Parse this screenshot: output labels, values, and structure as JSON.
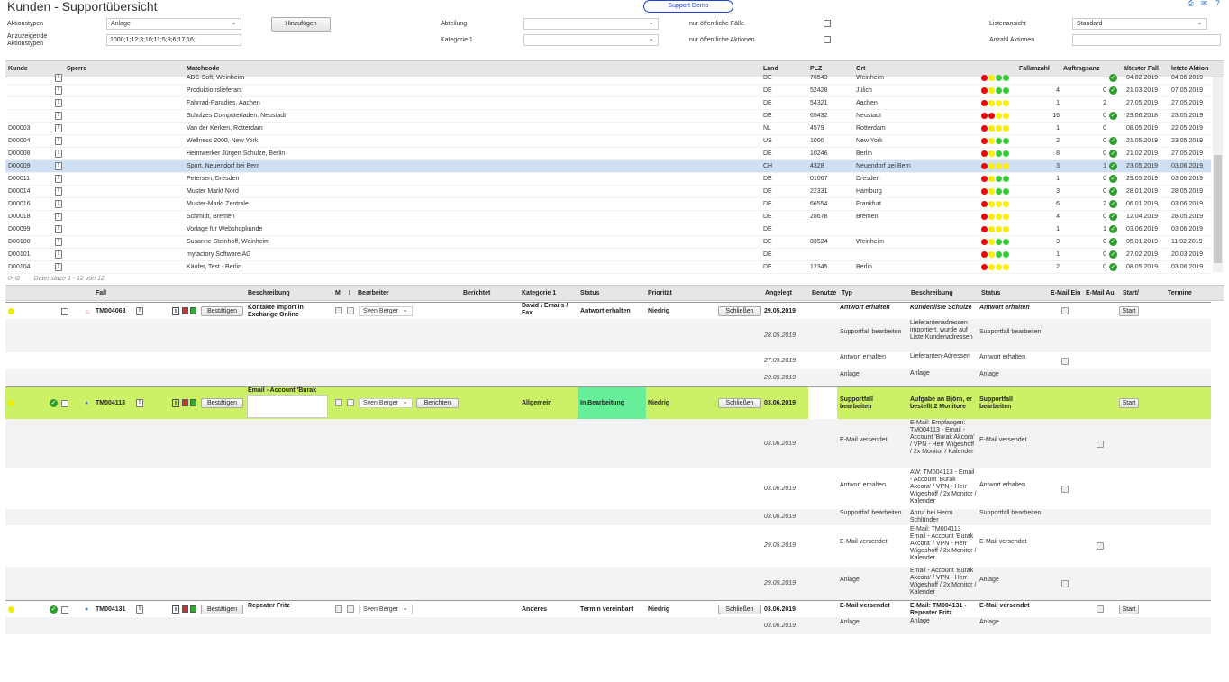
{
  "header": {
    "title": "Kunden - Supportübersicht",
    "demo": "Support Demo"
  },
  "filters": {
    "aktionstypen_label": "Aktionstypen",
    "aktionstypen_value": "Anlage",
    "anzuzeigende_label": "Anzuzeigende Aktionstypen",
    "anzuzeigende_value": "1000;1;12;3;10;11;5;9;6;17;16;",
    "add_btn": "Hinzufügen",
    "abteilung_label": "Abteilung",
    "kategorie_label": "Kategorie 1",
    "nur_faelle": "nur öffentliche Fälle",
    "nur_aktionen": "nur öffentliche Aktionen",
    "listenansicht_label": "Listenansicht",
    "listenansicht_value": "Standard",
    "anzahl_label": "Anzahl Aktionen"
  },
  "customer_grid": {
    "headers": {
      "kunde": "Kunde",
      "sperre": "Sperre",
      "matchcode": "Matchcode",
      "land": "Land",
      "plz": "PLZ",
      "ort": "Ort",
      "fallanzahl": "Fallanzahl",
      "auftrag": "Auftragsanz",
      "aeltester": "ältester Fall",
      "letzte": "letzte Aktion"
    },
    "rows": [
      {
        "kunde": "",
        "match": "ABC-Soft, Weinheim",
        "land": "DE",
        "plz": "76543",
        "ort": "Weinheim",
        "dots": [
          "#e00",
          "#fe0",
          "#3c3",
          "#3c3"
        ],
        "fall": "",
        "auf": "",
        "ok": true,
        "alt": "04.02.2019",
        "letzte": "04.06.2019"
      },
      {
        "kunde": "",
        "match": "Produktionslieferant",
        "land": "DE",
        "plz": "52428",
        "ort": "Jülich",
        "dots": [
          "#e00",
          "#fe0",
          "#3c3",
          "#3c3"
        ],
        "fall": "4",
        "auf": "0",
        "ok": true,
        "alt": "21.03.2019",
        "letzte": "07.05.2019"
      },
      {
        "kunde": "",
        "match": "Fahrrad-Paradies, Aachen",
        "land": "DE",
        "plz": "54321",
        "ort": "Aachen",
        "dots": [
          "#e00",
          "#fe0",
          "#fe0",
          "#fe0"
        ],
        "fall": "1",
        "auf": "2",
        "ok": false,
        "alt": "27.05.2019",
        "letzte": "27.05.2019"
      },
      {
        "kunde": "",
        "match": "Schulzes Computerladen, Neustadt",
        "land": "DE",
        "plz": "65432",
        "ort": "Neustadt",
        "dots": [
          "#e00",
          "#e00",
          "#fe0",
          "#fe0"
        ],
        "fall": "16",
        "auf": "0",
        "ok": true,
        "alt": "29.06.2018",
        "letzte": "23.05.2019"
      },
      {
        "kunde": "D00003",
        "match": "Van der Kerken, Rotterdam",
        "land": "NL",
        "plz": "4579",
        "ort": "Rotterdam",
        "dots": [
          "#e00",
          "#fe0",
          "#fe0",
          "#fe0"
        ],
        "fall": "1",
        "auf": "0",
        "ok": false,
        "alt": "08.05.2019",
        "letzte": "22.05.2019"
      },
      {
        "kunde": "D00004",
        "match": "Wellness 2000, New York",
        "land": "US",
        "plz": "1000",
        "ort": "New York",
        "dots": [
          "#e00",
          "#fe0",
          "#3c3",
          "#3c3"
        ],
        "fall": "2",
        "auf": "0",
        "ok": true,
        "alt": "21.05.2019",
        "letzte": "23.05.2019"
      },
      {
        "kunde": "D00008",
        "match": "Heimwerker Jürgen Schulze, Berlin",
        "land": "DE",
        "plz": "10246",
        "ort": "Berlin",
        "dots": [
          "#e00",
          "#fe0",
          "#3c3",
          "#3c3"
        ],
        "fall": "8",
        "auf": "0",
        "ok": true,
        "alt": "21.02.2019",
        "letzte": "27.05.2019"
      },
      {
        "kunde": "D00009",
        "match": "Sport, Neuendorf bei Bern",
        "land": "CH",
        "plz": "4328",
        "ort": "Neuendorf bei Bern",
        "dots": [
          "#e00",
          "#fe0",
          "#fe0",
          "#fe0"
        ],
        "fall": "3",
        "auf": "1",
        "ok": true,
        "alt": "23.05.2019",
        "letzte": "03.06.2019",
        "selected": true
      },
      {
        "kunde": "D00011",
        "match": "Petersen, Dresden",
        "land": "DE",
        "plz": "01067",
        "ort": "Dresden",
        "dots": [
          "#e00",
          "#fe0",
          "#3c3",
          "#3c3"
        ],
        "fall": "1",
        "auf": "0",
        "ok": true,
        "alt": "29.05.2019",
        "letzte": "03.06.2019"
      },
      {
        "kunde": "D00014",
        "match": "Muster Markt Nord",
        "land": "DE",
        "plz": "22331",
        "ort": "Hamburg",
        "dots": [
          "#e00",
          "#fe0",
          "#3c3",
          "#3c3"
        ],
        "fall": "3",
        "auf": "0",
        "ok": true,
        "alt": "28.01.2019",
        "letzte": "28.05.2019"
      },
      {
        "kunde": "D00016",
        "match": "Muster-Markt Zentrale",
        "land": "DE",
        "plz": "66554",
        "ort": "Frankfurt",
        "dots": [
          "#e00",
          "#fe0",
          "#fe0",
          "#fe0"
        ],
        "fall": "6",
        "auf": "2",
        "ok": true,
        "alt": "06.01.2019",
        "letzte": "03.06.2019"
      },
      {
        "kunde": "D00018",
        "match": "Schmidt, Bremen",
        "land": "DE",
        "plz": "28678",
        "ort": "Bremen",
        "dots": [
          "#e00",
          "#fe0",
          "#fe0",
          "#fe0"
        ],
        "fall": "4",
        "auf": "0",
        "ok": true,
        "alt": "12.04.2019",
        "letzte": "28.05.2019"
      },
      {
        "kunde": "D00099",
        "match": "Vorlage für Webshopkunde",
        "land": "DE",
        "plz": "",
        "ort": "",
        "dots": [
          "#e00",
          "#fe0",
          "#fe0",
          "#fe0"
        ],
        "fall": "1",
        "auf": "1",
        "ok": true,
        "alt": "03.06.2019",
        "letzte": "03.06.2019"
      },
      {
        "kunde": "D00100",
        "match": "Susanne Steinhoff, Weinheim",
        "land": "DE",
        "plz": "83524",
        "ort": "Weinheim",
        "dots": [
          "#e00",
          "#fe0",
          "#3c3",
          "#3c3"
        ],
        "fall": "3",
        "auf": "0",
        "ok": true,
        "alt": "05.01.2019",
        "letzte": "11.02.2019"
      },
      {
        "kunde": "D00101",
        "match": "mytactory Software AG",
        "land": "DE",
        "plz": "",
        "ort": "",
        "dots": [
          "#e00",
          "#fe0",
          "#3c3",
          "#3c3"
        ],
        "fall": "1",
        "auf": "0",
        "ok": true,
        "alt": "27.02.2019",
        "letzte": "20.03.2019"
      },
      {
        "kunde": "D00104",
        "match": "Käufer, Test - Berlin",
        "land": "DE",
        "plz": "12345",
        "ort": "Berlin",
        "dots": [
          "#e00",
          "#fe0",
          "#fe0",
          "#fe0"
        ],
        "fall": "2",
        "auf": "0",
        "ok": true,
        "alt": "08.05.2019",
        "letzte": "03.06.2019"
      }
    ],
    "footer": "Datensätze 1 - 12 von 12"
  },
  "case_grid": {
    "headers": {
      "fall": "Fall",
      "beschreibung": "Beschreibung",
      "m": "M",
      "i": "I",
      "bearbeiter": "Bearbeiter",
      "berichtet": "Berichtet",
      "kategorie": "Kategorie 1",
      "status": "Status",
      "prioritaet": "Priorität",
      "angelegt": "Angelegt",
      "benutzer": "Benutze",
      "typ": "Typ",
      "beschreibung2": "Beschreibung",
      "status2": "Status",
      "mail_ein": "E-Mail Ein",
      "mail_aus": "E-Mail Au",
      "start": "Start/",
      "termine": "Termine"
    },
    "confirm": "Bestätigen",
    "report": "Berichten",
    "close": "Schließen",
    "start_btn": "Start",
    "cases": [
      {
        "id": "TM004063",
        "beschreibung": "Kontakte import in Exchange Online",
        "bearbeiter": "Sven Berger",
        "kategorie": "David / Emails / Fax",
        "status": "Antwort erhalten",
        "prio": "Niedrig",
        "angelegt": "29.05.2019",
        "typ": "Antwort erhalten",
        "beschr2": "Kundenliste Schulze",
        "status2": "Antwort erhalten"
      },
      {
        "id": "TM004113",
        "beschreibung": "Email - Account 'Burak",
        "bearbeiter": "Sven Berger",
        "kategorie": "Allgemein",
        "status": "In Bearbeitung",
        "prio": "Niedrig",
        "angelegt": "03.06.2019",
        "typ": "Supportfall bearbeiten",
        "beschr2": "Aufgabe an Björn, er bestellt 2 Monitore",
        "status2": "Supportfall bearbeiten"
      },
      {
        "id": "TM004131",
        "beschreibung": "Repeater Fritz",
        "bearbeiter": "Sven Berger",
        "kategorie": "Anderes",
        "status": "Termin vereinbart",
        "prio": "Niedrig",
        "angelegt": "03.06.2019",
        "typ": "E-Mail versendet",
        "beschr2": "E-Mail: TM004131 - Repeater Fritz",
        "status2": "E-Mail versendet"
      }
    ],
    "sub1": [
      {
        "date": "28.05.2019",
        "typ": "Supportfall bearbeiten",
        "beschr": "Lieferantenadressen importiert, wurde auf Liste Kundenadressen",
        "status": "Supportfall bearbeiten"
      },
      {
        "date": "27.05.2019",
        "typ": "Antwort erhalten",
        "beschr": "Lieferanten-Adressen",
        "status": "Antwort erhalten"
      },
      {
        "date": "23.05.2019",
        "typ": "Anlage",
        "beschr": "Anlage",
        "status": "Anlage"
      }
    ],
    "sub2": [
      {
        "date": "03.06.2019",
        "typ": "E-Mail versendet",
        "beschr": "E-Mail: Empfangen: TM004113 - Email - Account 'Burak Akcora' / VPN - Herr Wigeshoff / 2x Monitor / Kalender",
        "status": "E-Mail versendet"
      },
      {
        "date": "03.06.2019",
        "typ": "Antwort erhalten",
        "beschr": "AW: TM004113 - Email - Account 'Burak Akcora' / VPN - Herr Wigeshoff / 2x Monitor / Kalender",
        "status": "Antwort erhalten"
      },
      {
        "date": "03.06.2019",
        "typ": "Supportfall bearbeiten",
        "beschr": "Anruf bei Herrn Schlünder",
        "status": "Supportfall bearbeiten"
      },
      {
        "date": "29.05.2019",
        "typ": "E-Mail versendet",
        "beschr": "E-Mail: TM004113 Email - Account 'Burak Akcora' / VPN - Herr Wigeshoff / 2x Monitor / Kalender",
        "status": "E-Mail versendet"
      },
      {
        "date": "29.05.2019",
        "typ": "Anlage",
        "beschr": "Email - Account 'Burak Akcora' / VPN - Herr Wigeshoff / 2x Monitor / Kalender",
        "status": "Anlage"
      }
    ],
    "sub3": [
      {
        "date": "03.06.2019",
        "typ": "Anlage",
        "beschr": "Anlage",
        "status": "Anlage"
      }
    ]
  }
}
